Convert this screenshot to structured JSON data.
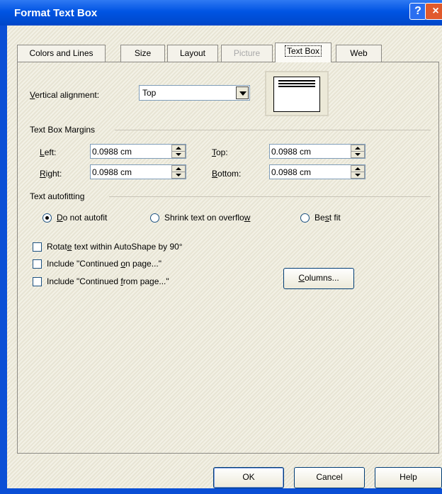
{
  "window": {
    "title": "Format Text Box",
    "help_icon": "?",
    "close_icon": "×"
  },
  "tabs": [
    {
      "label": "Colors and Lines",
      "state": "normal"
    },
    {
      "label": "Size",
      "state": "normal"
    },
    {
      "label": "Layout",
      "state": "normal"
    },
    {
      "label": "Picture",
      "state": "disabled"
    },
    {
      "label": "Text Box",
      "state": "active"
    },
    {
      "label": "Web",
      "state": "normal"
    }
  ],
  "vertical_alignment": {
    "label_u": "V",
    "label_rest": "ertical alignment:",
    "value": "Top"
  },
  "margins": {
    "group_label": "Text Box Margins",
    "left": {
      "u": "L",
      "rest": "eft:",
      "value": "0.0988 cm"
    },
    "right": {
      "u": "R",
      "rest": "ight:",
      "value": "0.0988 cm"
    },
    "top": {
      "u": "T",
      "rest": "op:",
      "value": "0.0988 cm"
    },
    "bottom": {
      "u": "B",
      "rest": "ottom:",
      "value": "0.0988 cm"
    }
  },
  "autofit": {
    "group_label": "Text autofitting",
    "options": [
      {
        "u": "D",
        "rest": "o not autofit",
        "checked": true
      },
      {
        "pre": "Shrink text on overflo",
        "u": "w",
        "checked": false
      },
      {
        "pre": "Be",
        "u": "s",
        "rest": "t fit",
        "checked": false
      }
    ]
  },
  "checkboxes": [
    {
      "pre": "Rotat",
      "u": "e",
      "rest": " text within AutoShape by 90°",
      "checked": false
    },
    {
      "pre": "Include \"Continued ",
      "u": "o",
      "rest": "n page...\"",
      "checked": false
    },
    {
      "pre": "Include \"Continued ",
      "u": "f",
      "rest": "rom page...\"",
      "checked": false
    }
  ],
  "columns_button": {
    "u": "C",
    "rest": "olumns..."
  },
  "footer": {
    "ok": "OK",
    "cancel": "Cancel",
    "help": "Help"
  }
}
